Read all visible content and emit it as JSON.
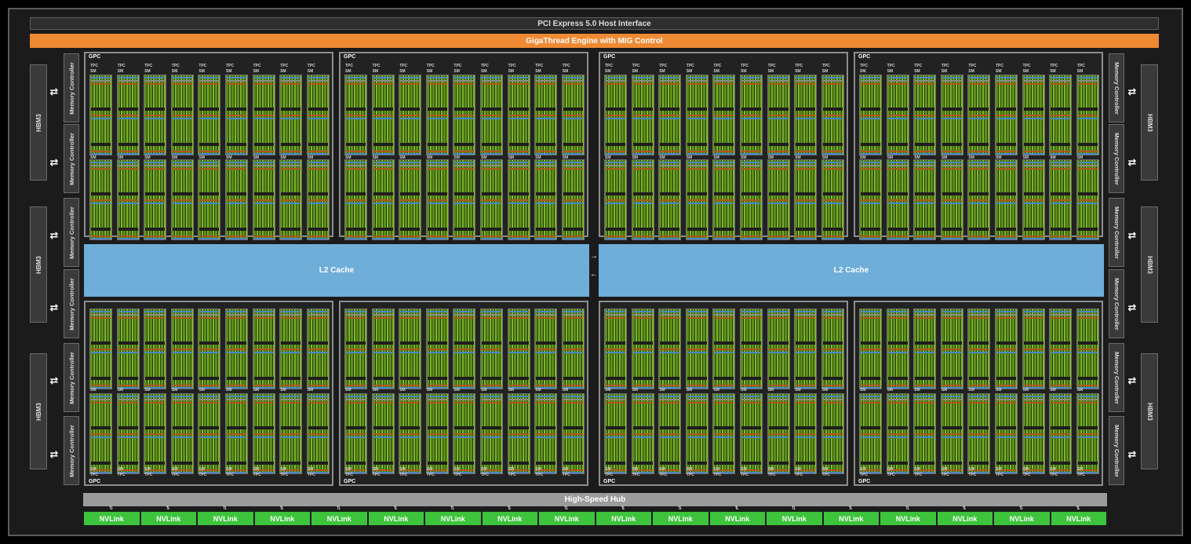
{
  "header": {
    "pcie_label": "PCI Express 5.0 Host Interface",
    "gigathread_label": "GigaThread Engine with MIG Control"
  },
  "cache": {
    "left_label": "L2 Cache",
    "right_label": "L2 Cache"
  },
  "hub_label": "High-Speed Hub",
  "memory": {
    "hbm_label": "HBM3",
    "controller_label": "Memory Controller",
    "hbm_left_count": 3,
    "hbm_right_count": 3,
    "controllers_per_side": 6
  },
  "gpc": {
    "label": "GPC",
    "tpc_label": "TPC",
    "sm_label": "SM",
    "count": 8,
    "tpcs_per_gpc": 9
  },
  "nvlink": {
    "label": "NVLink",
    "count": 18
  },
  "colors": {
    "gigathread": "#ef8a34",
    "l2_cache": "#6eaed9",
    "nvlink": "#3ec33d",
    "sm_core": "#5c8f1c",
    "hub": "#9b9b9b"
  }
}
